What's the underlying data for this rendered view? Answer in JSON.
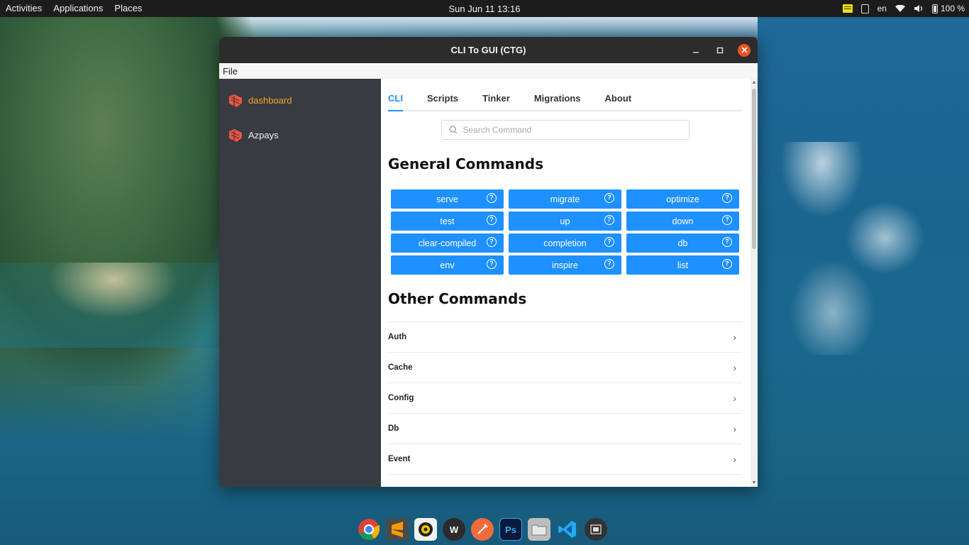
{
  "topbar": {
    "activities": "Activities",
    "applications": "Applications",
    "places": "Places",
    "clock": "Sun Jun 11  13:16",
    "lang": "en",
    "battery": "100 %"
  },
  "window": {
    "title": "CLI To GUI (CTG)",
    "menu_file": "File",
    "close_glyph": "✕",
    "minimize_glyph": "—",
    "maximize_glyph": "□"
  },
  "sidebar": {
    "items": [
      {
        "label": "dashboard",
        "active": true
      },
      {
        "label": "Azpays",
        "active": false
      }
    ]
  },
  "tabs": [
    "CLI",
    "Scripts",
    "Tinker",
    "Migrations",
    "About"
  ],
  "search": {
    "placeholder": "Search Command"
  },
  "general": {
    "title": "General Commands",
    "commands": [
      "serve",
      "migrate",
      "optimize",
      "test",
      "up",
      "down",
      "clear-compiled",
      "completion",
      "db",
      "env",
      "inspire",
      "list"
    ]
  },
  "other": {
    "title": "Other Commands",
    "groups": [
      "Auth",
      "Cache",
      "Config",
      "Db",
      "Event"
    ]
  },
  "dock": {
    "icons": [
      "chrome-icon",
      "sublime-icon",
      "rhythmbox-icon",
      "wps-icon",
      "postman-icon",
      "photoshop-icon",
      "files-icon",
      "vscode-icon",
      "screenshot-icon"
    ],
    "photoshop_label": "Ps",
    "wps_label": "W"
  },
  "colors": {
    "accent": "#1e90ff",
    "sidebar_bg": "#383b42",
    "active_sidebar": "#f5a623",
    "close_button": "#e95420"
  }
}
